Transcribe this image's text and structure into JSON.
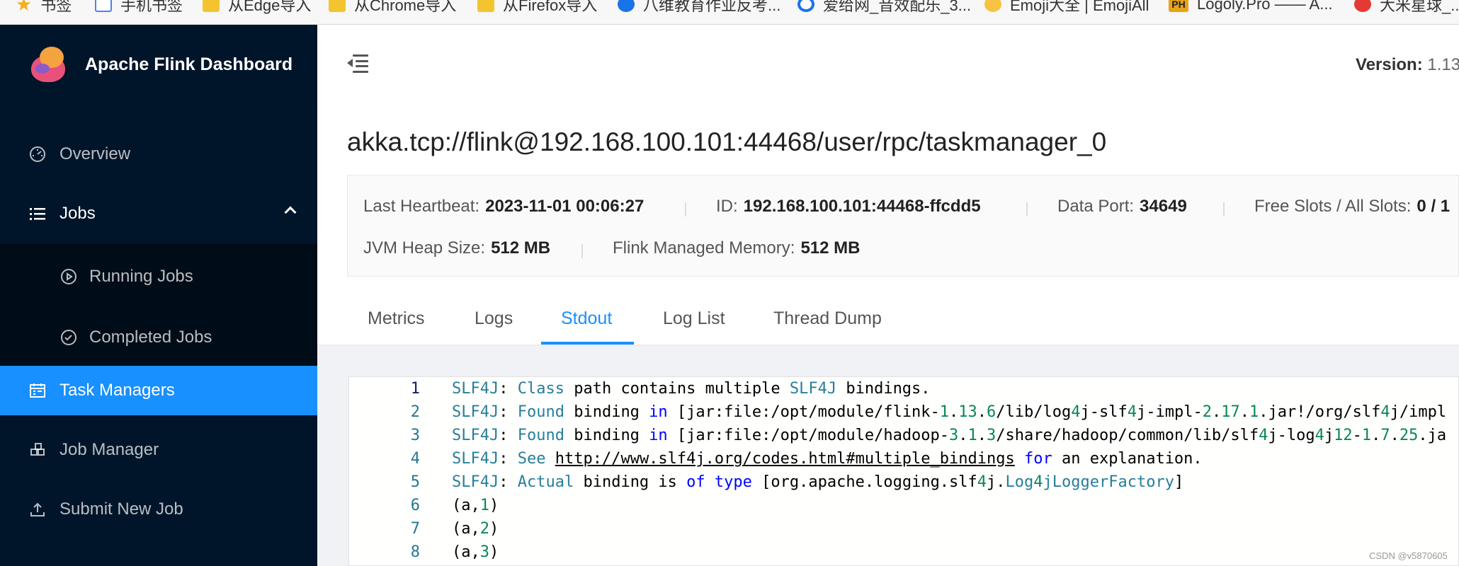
{
  "bookmarks": [
    {
      "icon": "star-icon",
      "label": "书签"
    },
    {
      "icon": "page-icon",
      "label": "手机书签"
    },
    {
      "icon": "folder-icon",
      "label": "从Edge导入"
    },
    {
      "icon": "folder-icon",
      "label": "从Chrome导入"
    },
    {
      "icon": "folder-icon",
      "label": "从Firefox导入"
    },
    {
      "icon": "globe-icon",
      "label": "八维教育作业反考..."
    },
    {
      "icon": "ring-icon",
      "label": "爱给网_音效配乐_3..."
    },
    {
      "icon": "emoji-icon",
      "label": "Emoji大全 | EmojiAll"
    },
    {
      "icon": "ph-icon",
      "label": "Logoly.Pro —— A..."
    },
    {
      "icon": "red-icon",
      "label": "大米星球_..."
    }
  ],
  "sidebar": {
    "brand": "Apache Flink Dashboard",
    "items": [
      {
        "label": "Overview",
        "icon": "dashboard-icon"
      },
      {
        "label": "Jobs",
        "icon": "list-icon"
      },
      {
        "label": "Running Jobs",
        "icon": "play-circle-icon"
      },
      {
        "label": "Completed Jobs",
        "icon": "check-circle-icon"
      },
      {
        "label": "Task Managers",
        "icon": "schedule-icon"
      },
      {
        "label": "Job Manager",
        "icon": "cluster-icon"
      },
      {
        "label": "Submit New Job",
        "icon": "upload-icon"
      }
    ]
  },
  "header": {
    "version_label": "Version:",
    "version_value": "1.13."
  },
  "main": {
    "title": "akka.tcp://flink@192.168.100.101:44468/user/rpc/taskmanager_0",
    "details": {
      "heartbeat_label": "Last Heartbeat:",
      "heartbeat_value": "2023-11-01 00:06:27",
      "id_label": "ID:",
      "id_value": "192.168.100.101:44468-ffcdd5",
      "port_label": "Data Port:",
      "port_value": "34649",
      "slots_label": "Free Slots / All Slots:",
      "slots_value": "0 / 1",
      "heap_label": "JVM Heap Size:",
      "heap_value": "512 MB",
      "memory_label": "Flink Managed Memory:",
      "memory_value": "512 MB"
    },
    "tabs": [
      "Metrics",
      "Logs",
      "Stdout",
      "Log List",
      "Thread Dump"
    ],
    "active_tab": "Stdout"
  },
  "stdout": {
    "line_numbers": [
      "1",
      "2",
      "3",
      "4",
      "5",
      "6",
      "7",
      "8"
    ],
    "lines": [
      "SLF4J: Class path contains multiple SLF4J bindings.",
      "SLF4J: Found binding in [jar:file:/opt/module/flink-1.13.6/lib/log4j-slf4j-impl-2.17.1.jar!/org/slf4j/impl",
      "SLF4J: Found binding in [jar:file:/opt/module/hadoop-3.1.3/share/hadoop/common/lib/slf4j-log4j12-1.7.25.ja",
      "SLF4J: See http://www.slf4j.org/codes.html#multiple_bindings for an explanation.",
      "SLF4J: Actual binding is of type [org.apache.logging.slf4j.Log4jLoggerFactory]",
      "(a,1)",
      "(a,2)",
      "(a,3)"
    ]
  },
  "watermark": "CSDN @v5870605",
  "colors": {
    "sidebar": "#001529",
    "accent": "#1890ff",
    "submenu": "#000c17"
  }
}
